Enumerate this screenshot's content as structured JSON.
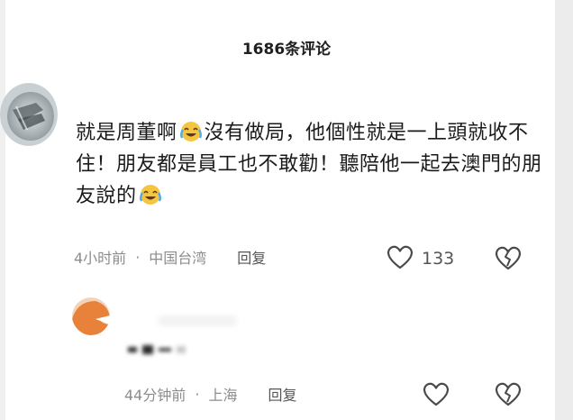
{
  "header": {
    "title": "1686条评论"
  },
  "comments": [
    {
      "text_parts": [
        "就是周董啊",
        "沒有做局，他個性就是一上頭就收不住！朋友都是員工也不敢勸！聽陪他一起去澳門的朋友說的"
      ],
      "meta": {
        "time": "4小时前",
        "location": "中国台湾",
        "reply": "回复"
      },
      "likes": "133"
    },
    {
      "meta": {
        "time": "44分钟前",
        "location": "上海",
        "reply": "回复"
      }
    }
  ],
  "separator": "·",
  "icons": {
    "like": "heart-outline-icon",
    "dislike": "broken-heart-icon",
    "emoji": "laughing-crying-emoji"
  },
  "colors": {
    "text": "#1a1a1a",
    "meta": "#8c8c8c",
    "avatar2": "#e8823a",
    "emoji": "#f5c542"
  }
}
